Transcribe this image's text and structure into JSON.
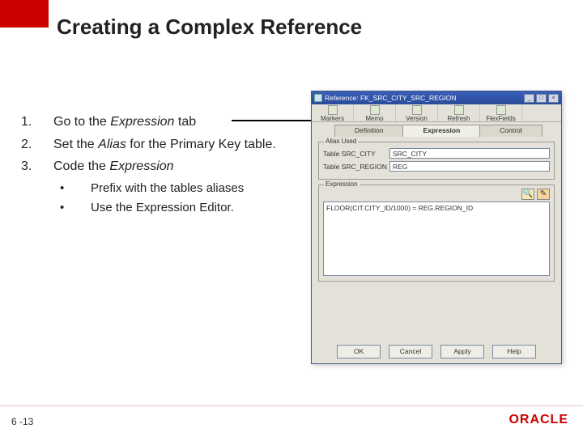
{
  "slide": {
    "title": "Creating a Complex Reference",
    "page_number": "6 -13",
    "logo": "ORACLE"
  },
  "steps": {
    "items": [
      {
        "num": "1.",
        "pre": "Go to the ",
        "italic": "Expression",
        "post": " tab"
      },
      {
        "num": "2.",
        "pre": "Set the ",
        "italic": "Alias",
        "post": " for the Primary Key table."
      },
      {
        "num": "3.",
        "pre": "Code the ",
        "italic": "Expression",
        "post": ""
      }
    ],
    "bullets": [
      {
        "text": "Prefix with the tables aliases"
      },
      {
        "text": "Use the Expression Editor."
      }
    ]
  },
  "dialog": {
    "title": "Reference: FK_SRC_CITY_SRC_REGION",
    "window_controls": {
      "min": "_",
      "max": "□",
      "close": "×"
    },
    "toolbar": [
      {
        "label": "Markers"
      },
      {
        "label": "Memo"
      },
      {
        "label": "Version"
      },
      {
        "label": "Refresh"
      },
      {
        "label": "FlexFields"
      }
    ],
    "tabs": [
      {
        "label": "Definition",
        "active": false
      },
      {
        "label": "Expression",
        "active": true
      },
      {
        "label": "Control",
        "active": false
      }
    ],
    "alias_group": {
      "label": "Alias Used",
      "rows": [
        {
          "label": "Table SRC_CITY",
          "value": "SRC_CITY"
        },
        {
          "label": "Table SRC_REGION",
          "value": "REG"
        }
      ]
    },
    "expression_group": {
      "label": "Expression",
      "icons": {
        "search": "🔍",
        "pencil": "✎"
      },
      "expression": "FLOOR(CIT.CITY_ID/1000) = REG.REGION_ID"
    },
    "buttons": [
      "OK",
      "Cancel",
      "Apply",
      "Help"
    ]
  }
}
